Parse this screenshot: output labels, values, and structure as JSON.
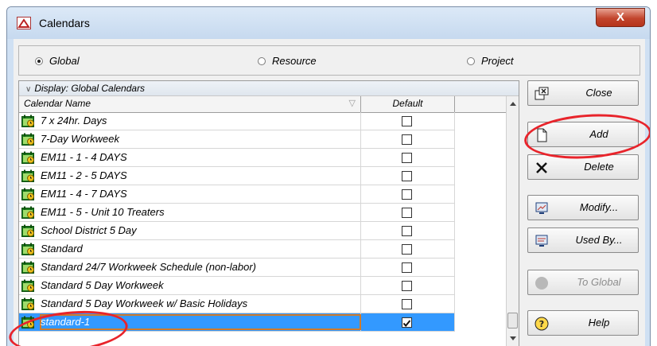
{
  "window": {
    "title": "Calendars",
    "close_glyph": "X"
  },
  "scope": [
    {
      "label": "Global",
      "selected": true
    },
    {
      "label": "Resource",
      "selected": false
    },
    {
      "label": "Project",
      "selected": false
    }
  ],
  "display_bar": {
    "label": "Display: Global Calendars"
  },
  "columns": {
    "name": "Calendar Name",
    "default": "Default"
  },
  "calendars": [
    {
      "name": "7 x 24hr. Days",
      "default": false
    },
    {
      "name": "7-Day Workweek",
      "default": false
    },
    {
      "name": "EM11 - 1 - 4 DAYS",
      "default": false
    },
    {
      "name": "EM11 - 2 - 5 DAYS",
      "default": false
    },
    {
      "name": "EM11 - 4 - 7 DAYS",
      "default": false
    },
    {
      "name": "EM11 - 5 - Unit 10 Treaters",
      "default": false
    },
    {
      "name": "School District 5 Day",
      "default": false
    },
    {
      "name": "Standard",
      "default": false
    },
    {
      "name": "Standard 24/7 Workweek Schedule (non-labor)",
      "default": false
    },
    {
      "name": "Standard 5 Day Workweek",
      "default": false
    },
    {
      "name": "Standard 5 Day Workweek w/ Basic Holidays",
      "default": false
    },
    {
      "name": "standard-1",
      "default": true,
      "selected": true
    }
  ],
  "buttons": {
    "close": "Close",
    "add": "Add",
    "delete": "Delete",
    "modify": "Modify...",
    "used_by": "Used By...",
    "to_global": "To Global",
    "help": "Help"
  },
  "colors": {
    "selection": "#3399ff",
    "annotation": "#e8242b",
    "window_frame": "#cfe0f3",
    "close_button": "#c2452d"
  },
  "icons": {
    "app": "calendars-app-icon",
    "calendar_row": "calendar-icon",
    "close": "close-window-icon",
    "add": "new-document-icon",
    "delete": "x-delete-icon",
    "modify": "monitor-edit-icon",
    "used_by": "monitor-list-icon",
    "to_global": "gray-circle-icon",
    "help": "question-mark-icon"
  }
}
